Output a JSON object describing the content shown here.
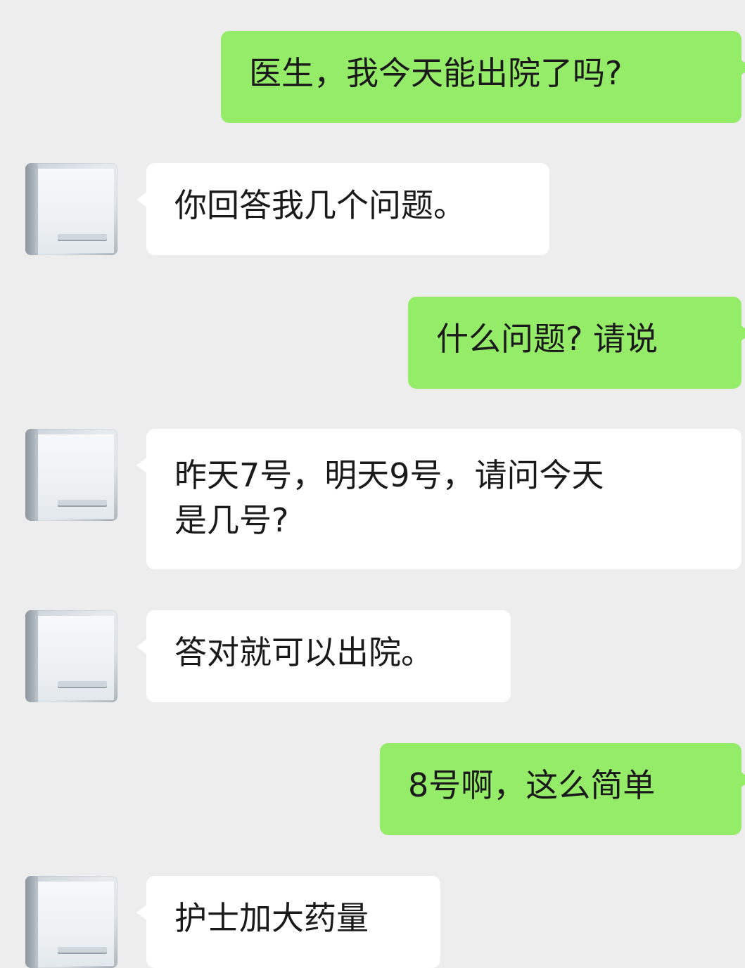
{
  "messages": [
    {
      "side": "right",
      "text": "医生，我今天能出院了吗?"
    },
    {
      "side": "left",
      "text": "你回答我几个问题。"
    },
    {
      "side": "right",
      "text": "什么问题? 请说"
    },
    {
      "side": "left",
      "text": "昨天7号，明天9号，请问今天\n是几号?"
    },
    {
      "side": "left",
      "text": "答对就可以出院。"
    },
    {
      "side": "right",
      "text": "8号啊，这么简单"
    },
    {
      "side": "left",
      "text": "护士加大药量"
    }
  ],
  "colors": {
    "background": "#ededed",
    "my_bubble": "#95ec69",
    "their_bubble": "#ffffff"
  }
}
